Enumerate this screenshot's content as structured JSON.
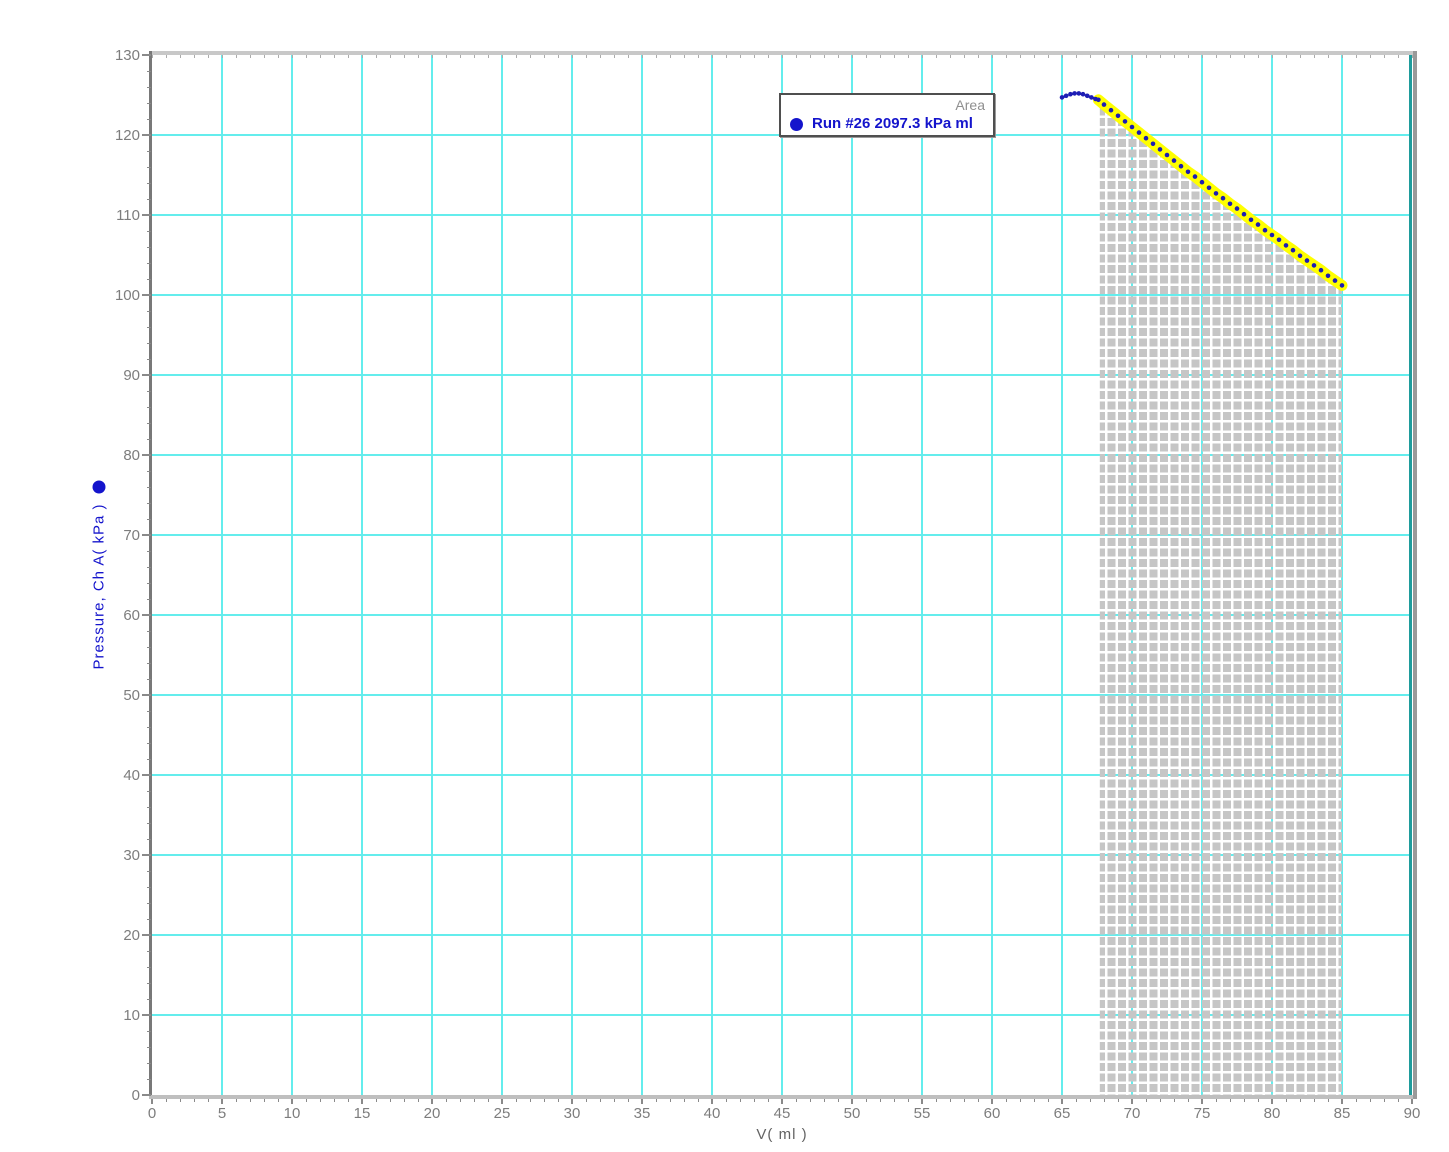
{
  "chart_data": {
    "type": "scatter",
    "title": "",
    "xlabel": "V( ml )",
    "ylabel": "Pressure, Ch A( kPa )",
    "xlim": [
      0,
      90
    ],
    "ylim": [
      0,
      130
    ],
    "x_ticks": [
      0,
      5,
      10,
      15,
      20,
      25,
      30,
      35,
      40,
      45,
      50,
      55,
      60,
      65,
      70,
      75,
      80,
      85,
      90
    ],
    "y_ticks": [
      0,
      10,
      20,
      30,
      40,
      50,
      60,
      70,
      80,
      90,
      100,
      110,
      120,
      130
    ],
    "x_minor_step": 1,
    "y_minor_step": 2,
    "grid": "on",
    "grid_color": "#64eded",
    "axis_color": "#787878",
    "tick_label_color": "#7d7d7d",
    "legend": {
      "position": "top-right-of-center",
      "area_label": "Area",
      "run_label": "Run #26  2097.3 kPa ml",
      "marker_color": "#1414cc"
    },
    "series": [
      {
        "name": "Run #26",
        "marker_color": "#1414cc",
        "points": [
          [
            65.0,
            124.7
          ],
          [
            65.3,
            124.9
          ],
          [
            65.6,
            125.1
          ],
          [
            65.9,
            125.2
          ],
          [
            66.2,
            125.2
          ],
          [
            66.5,
            125.1
          ],
          [
            66.8,
            124.9
          ],
          [
            67.1,
            124.7
          ],
          [
            67.4,
            124.5
          ],
          [
            67.6,
            124.4
          ],
          [
            68.0,
            123.8
          ],
          [
            68.5,
            123.1
          ],
          [
            69.0,
            122.4
          ],
          [
            69.5,
            121.7
          ],
          [
            70.0,
            121.0
          ],
          [
            70.5,
            120.3
          ],
          [
            71.0,
            119.6
          ],
          [
            71.5,
            118.9
          ],
          [
            72.0,
            118.2
          ],
          [
            72.5,
            117.5
          ],
          [
            73.0,
            116.8
          ],
          [
            73.5,
            116.1
          ],
          [
            74.0,
            115.4
          ],
          [
            74.5,
            114.8
          ],
          [
            75.0,
            114.1
          ],
          [
            75.5,
            113.4
          ],
          [
            76.0,
            112.7
          ],
          [
            76.5,
            112.1
          ],
          [
            77.0,
            111.4
          ],
          [
            77.5,
            110.8
          ],
          [
            78.0,
            110.1
          ],
          [
            78.5,
            109.4
          ],
          [
            79.0,
            108.8
          ],
          [
            79.5,
            108.1
          ],
          [
            80.0,
            107.5
          ],
          [
            80.5,
            106.9
          ],
          [
            81.0,
            106.2
          ],
          [
            81.5,
            105.6
          ],
          [
            82.0,
            104.9
          ],
          [
            82.5,
            104.3
          ],
          [
            83.0,
            103.7
          ],
          [
            83.5,
            103.1
          ],
          [
            84.0,
            102.4
          ],
          [
            84.5,
            101.8
          ],
          [
            85.0,
            101.2
          ]
        ]
      }
    ],
    "highlight": {
      "color": "#ffff00",
      "v_start": 67.6,
      "v_end": 85.0
    },
    "area_selection": {
      "fill": "#c6c6c6",
      "v_start": 67.7,
      "v_end": 85.0,
      "value": "2097.3 kPa ml"
    }
  }
}
